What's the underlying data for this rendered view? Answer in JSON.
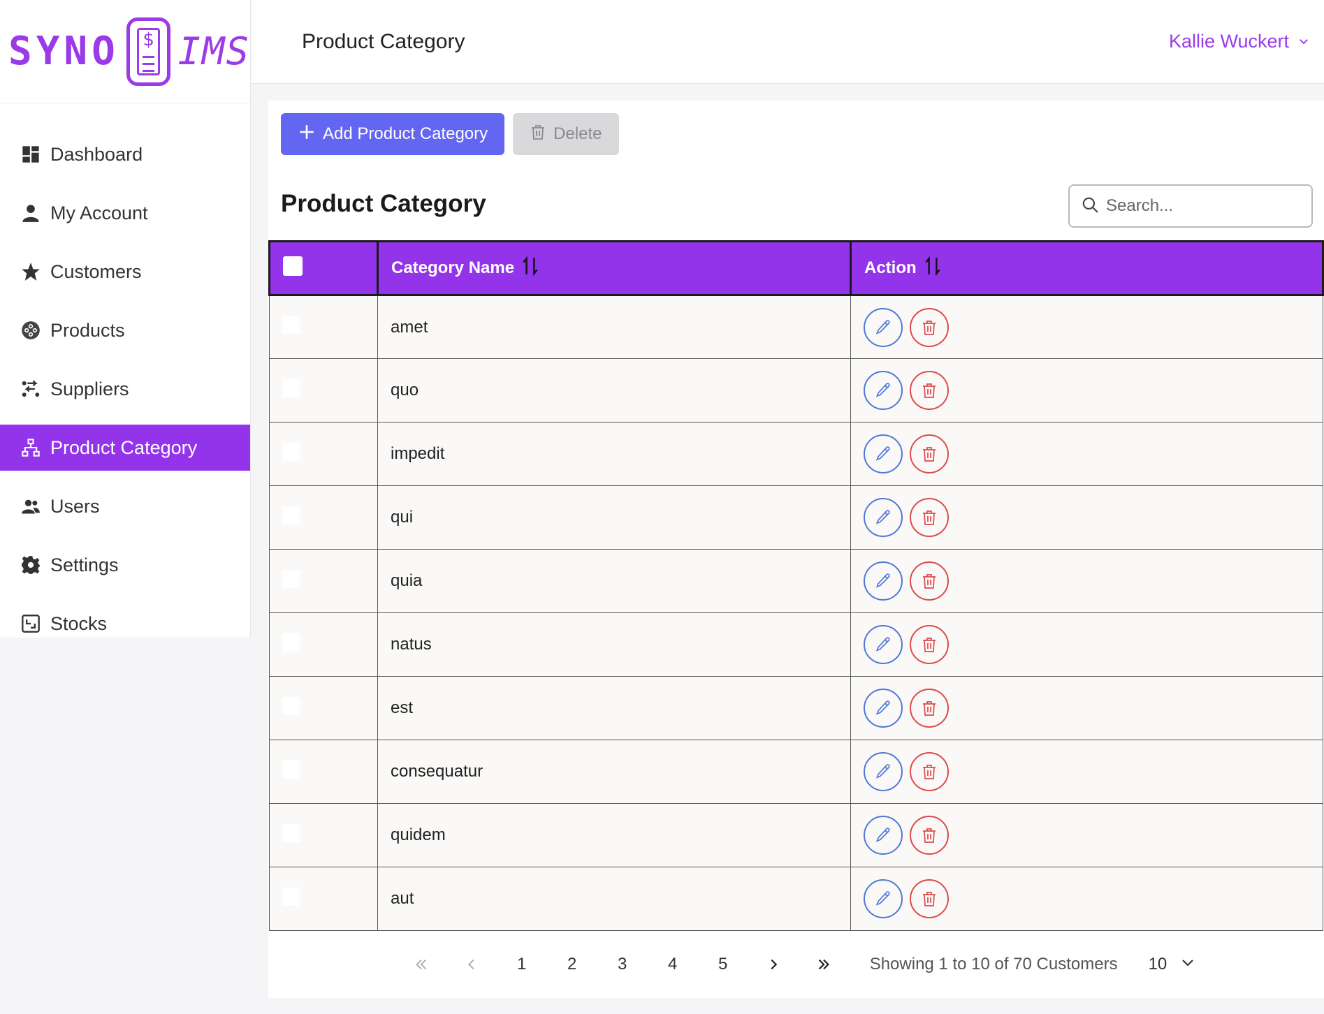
{
  "logo": {
    "left": "SYNO",
    "right": "IMS",
    "symbol": "$"
  },
  "sidebar": {
    "items": [
      {
        "label": "Dashboard",
        "icon": "dashboard-icon"
      },
      {
        "label": "My Account",
        "icon": "user-icon"
      },
      {
        "label": "Customers",
        "icon": "star-icon"
      },
      {
        "label": "Products",
        "icon": "products-icon"
      },
      {
        "label": "Suppliers",
        "icon": "suppliers-icon"
      },
      {
        "label": "Product Category",
        "icon": "sitemap-icon",
        "active": true
      },
      {
        "label": "Users",
        "icon": "users-icon"
      },
      {
        "label": "Settings",
        "icon": "gear-icon"
      },
      {
        "label": "Stocks",
        "icon": "stocks-icon"
      }
    ]
  },
  "header": {
    "title": "Product Category",
    "user_name": "Kallie Wuckert"
  },
  "toolbar": {
    "add_label": "Add Product Category",
    "delete_label": "Delete"
  },
  "main": {
    "title": "Product Category",
    "search_placeholder": "Search...",
    "columns": {
      "name": "Category Name",
      "action": "Action"
    },
    "rows": [
      "amet",
      "quo",
      "impedit",
      "qui",
      "quia",
      "natus",
      "est",
      "consequatur",
      "quidem",
      "aut"
    ]
  },
  "pagination": {
    "pages": [
      "1",
      "2",
      "3",
      "4",
      "5"
    ],
    "info": "Showing 1 to 10 of 70 Customers",
    "rows_per_page": "10"
  },
  "colors": {
    "accent": "#9333ea",
    "primary_button": "#6366f1",
    "edit": "#4f78d6",
    "delete": "#dc4a4a"
  }
}
